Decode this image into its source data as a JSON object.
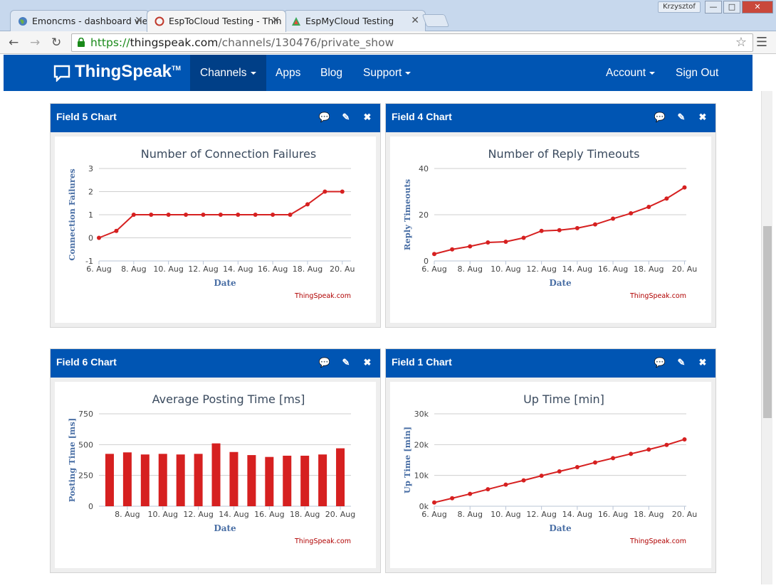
{
  "browser": {
    "tabs": [
      {
        "label": "Emoncms - dashboard vie",
        "icon": "globe-icon"
      },
      {
        "label": "EspToCloud Testing - Thin",
        "icon": "thingspeak-icon"
      },
      {
        "label": "EspMyCloud Testing",
        "icon": "triangle-icon"
      }
    ],
    "user": "Krzysztof",
    "url_scheme": "https://",
    "url_host": "thingspeak.com",
    "url_path": "/channels/130476/private_show"
  },
  "navbar": {
    "brand": "ThingSpeak",
    "brand_tm": "TM",
    "items": [
      "Channels",
      "Apps",
      "Blog",
      "Support"
    ],
    "account": "Account",
    "signout": "Sign Out"
  },
  "panels": [
    {
      "title": "Field 5 Chart"
    },
    {
      "title": "Field 4 Chart"
    },
    {
      "title": "Field 6 Chart"
    },
    {
      "title": "Field 1 Chart"
    }
  ],
  "colors": {
    "series": "#d62020",
    "brand_blue": "#0055b3",
    "axis_label": "#4a6fa5",
    "credit": "#b00000"
  },
  "chart_data": [
    {
      "type": "line",
      "title": "Number of Connection Failures",
      "xlabel": "Date",
      "ylabel": "Connection Failures",
      "x_ticks": [
        "6. Aug",
        "8. Aug",
        "10. Aug",
        "12. Aug",
        "14. Aug",
        "16. Aug",
        "18. Aug",
        "20. Au"
      ],
      "y_ticks": [
        "3",
        "2",
        "1",
        "0",
        "-1"
      ],
      "ylim": [
        -1,
        3
      ],
      "xlim": [
        6,
        20.5
      ],
      "x": [
        6,
        7,
        8,
        9,
        10,
        11,
        12,
        13,
        14,
        15,
        16,
        17,
        18,
        19,
        20
      ],
      "y": [
        0,
        0.3,
        1,
        1,
        1,
        1,
        1,
        1,
        1,
        1,
        1,
        1,
        1.45,
        2,
        2
      ],
      "credit": "ThingSpeak.com"
    },
    {
      "type": "line",
      "title": "Number of Reply Timeouts",
      "xlabel": "Date",
      "ylabel": "Reply Timeouts",
      "x_ticks": [
        "6. Aug",
        "8. Aug",
        "10. Aug",
        "12. Aug",
        "14. Aug",
        "16. Aug",
        "18. Aug",
        "20. Au"
      ],
      "y_ticks": [
        "40",
        "20",
        "0"
      ],
      "ylim": [
        0,
        40
      ],
      "xlim": [
        6,
        20.1
      ],
      "x": [
        6,
        7,
        8,
        9,
        10,
        11,
        12,
        13,
        14,
        15,
        16,
        17,
        18,
        19,
        20
      ],
      "y": [
        3,
        5,
        6.3,
        8,
        8.3,
        10,
        13,
        13.3,
        14.2,
        15.8,
        18.3,
        20.6,
        23.4,
        27,
        31.8
      ],
      "credit": "ThingSpeak.com"
    },
    {
      "type": "bar",
      "title": "Average Posting Time [ms]",
      "xlabel": "Date",
      "ylabel": "Posting Time [ms]",
      "x_ticks": [
        "8. Aug",
        "10. Aug",
        "12. Aug",
        "14. Aug",
        "16. Aug",
        "18. Aug",
        "20. Aug"
      ],
      "y_ticks": [
        "750",
        "500",
        "250",
        "0"
      ],
      "ylim": [
        0,
        750
      ],
      "xlim": [
        6.4,
        20.6
      ],
      "x": [
        7,
        8,
        9,
        10,
        11,
        12,
        13,
        14,
        15,
        16,
        17,
        18,
        19,
        20
      ],
      "values": [
        425,
        437,
        420,
        425,
        420,
        425,
        510,
        440,
        415,
        400,
        410,
        410,
        420,
        470
      ],
      "credit": "ThingSpeak.com"
    },
    {
      "type": "line",
      "title": "Up Time [min]",
      "xlabel": "Date",
      "ylabel": "Up Time [min]",
      "x_ticks": [
        "6. Aug",
        "8. Aug",
        "10. Aug",
        "12. Aug",
        "14. Aug",
        "16. Aug",
        "18. Aug",
        "20. Au"
      ],
      "y_ticks": [
        "30k",
        "20k",
        "10k",
        "0k"
      ],
      "ylim": [
        0,
        30000
      ],
      "xlim": [
        6,
        20.1
      ],
      "x": [
        6,
        7,
        8,
        9,
        10,
        11,
        12,
        13,
        14,
        15,
        16,
        17,
        18,
        19,
        20
      ],
      "y": [
        1200,
        2600,
        4000,
        5500,
        7000,
        8400,
        9900,
        11300,
        12700,
        14200,
        15600,
        17000,
        18400,
        19900,
        21700
      ],
      "credit": "ThingSpeak.com"
    }
  ]
}
